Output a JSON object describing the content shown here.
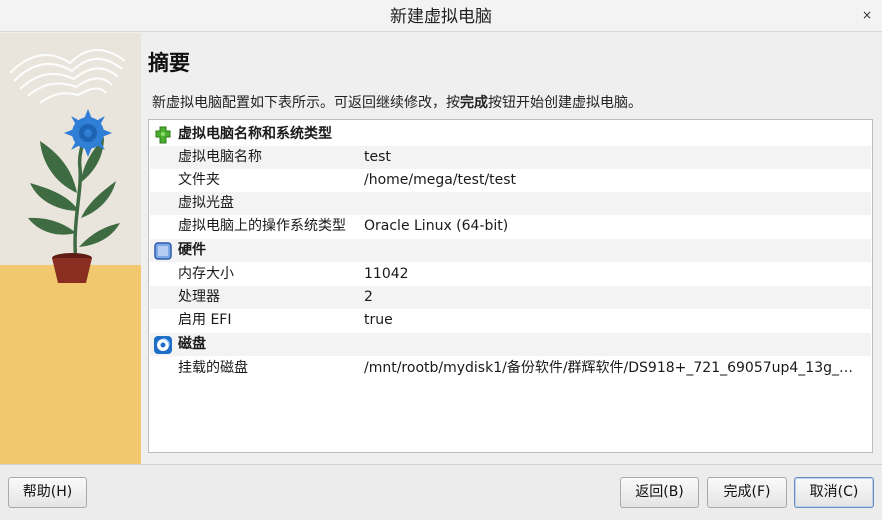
{
  "window": {
    "title": "新建虚拟电脑",
    "close_glyph": "×"
  },
  "page": {
    "title": "摘要",
    "desc_before": "新虚拟电脑配置如下表所示。可返回继续修改，按",
    "desc_bold": "完成",
    "desc_after": "按钮开始创建虚拟电脑。"
  },
  "summary": {
    "sections": [
      {
        "title": "虚拟电脑名称和系统类型",
        "icon": "green-puzzle-icon",
        "rows": [
          {
            "key": "虚拟电脑名称",
            "value": "test"
          },
          {
            "key": "文件夹",
            "value": "/home/mega/test/test"
          },
          {
            "key": "虚拟光盘",
            "value": ""
          },
          {
            "key": "虚拟电脑上的操作系统类型",
            "value": "Oracle Linux (64-bit)"
          }
        ]
      },
      {
        "title": "硬件",
        "icon": "chip-icon",
        "rows": [
          {
            "key": "内存大小",
            "value": "11042"
          },
          {
            "key": "处理器",
            "value": "2"
          },
          {
            "key": "启用 EFI",
            "value": "true"
          }
        ]
      },
      {
        "title": "磁盘",
        "icon": "disk-icon",
        "rows": [
          {
            "key": "挂载的磁盘",
            "value": "/mnt/rootb/mydisk1/备份软件/群辉软件/DS918+_721_69057up4_13g_…"
          }
        ]
      }
    ]
  },
  "buttons": {
    "help": "帮助(H)",
    "back": "返回(B)",
    "finish": "完成(F)",
    "cancel": "取消(C)"
  },
  "colors": {
    "accent": "#6a8fc0",
    "side_bg": "#eae5dc",
    "side_table": "#f2c86e",
    "flower": "#2f7fd6",
    "leaf": "#3f6b43",
    "pot": "#8a2e22"
  }
}
